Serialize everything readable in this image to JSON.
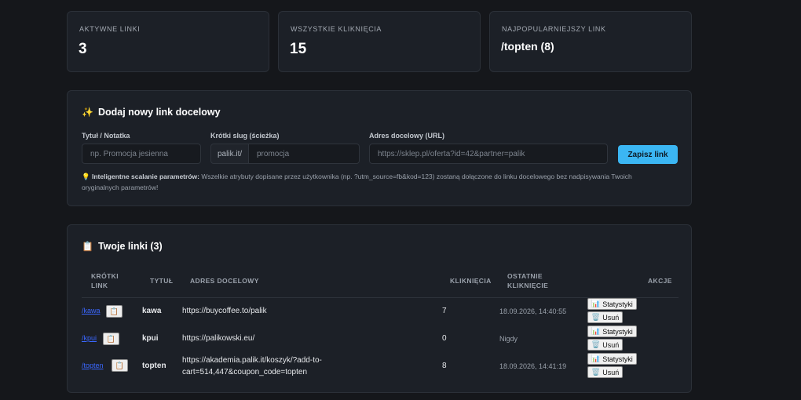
{
  "stats": [
    {
      "label": "AKTYWNE LINKI",
      "value": "3"
    },
    {
      "label": "WSZYSTKIE KLIKNIĘCIA",
      "value": "15"
    },
    {
      "label": "NAJPOPULARNIEJSZY LINK",
      "value": "/topten (8)"
    }
  ],
  "form": {
    "icon": "✨",
    "title": "Dodaj nowy link docelowy",
    "title_label": "Tytuł / Notatka",
    "title_placeholder": "np. Promocja jesienna",
    "slug_label": "Krótki slug (ścieżka)",
    "slug_prefix": "palik.it/",
    "slug_placeholder": "promocja",
    "url_label": "Adres docelowy (URL)",
    "url_placeholder": "https://sklep.pl/oferta?id=42&partner=palik",
    "save_label": "Zapisz link",
    "hint_icon": "💡",
    "hint_bold": "Inteligentne scalanie parametrów:",
    "hint_line1": " Wszelkie atrybuty dopisane przez użytkownika (np. ?utm_source=fb&kod=123) zostaną dołączone do linku docelowego bez nadpisywania Twoich",
    "hint_line2": "oryginalnych parametrów!"
  },
  "links": {
    "icon": "📋",
    "title": "Twoje linki (3)",
    "headers": {
      "short_1": "KRÓTKI",
      "short_2": "LINK",
      "title": "TYTUŁ",
      "target": "ADRES DOCELOWY",
      "clicks": "KLIKNIĘCIA",
      "last_1": "OSTATNIE",
      "last_2": "KLIKNIĘCIE",
      "actions": "AKCJE"
    },
    "copy_icon": "📋",
    "stats_icon": "📊",
    "stats_label": "Statystyki",
    "delete_icon": "🗑️",
    "delete_label": "Usuń",
    "rows": [
      {
        "short": "/kawa",
        "title": "kawa",
        "url_1": "https://buycoffee.to/palik",
        "url_2": "",
        "clicks": "7",
        "last": "18.09.2026, 14:40:55"
      },
      {
        "short": "/kpui",
        "title": "kpui",
        "url_1": "https://palikowski.eu/",
        "url_2": "",
        "clicks": "0",
        "last": "Nigdy"
      },
      {
        "short": "/topten",
        "title": "topten",
        "url_1": "https://akademia.palik.it/koszyk/?add-to-",
        "url_2": "cart=514,447&coupon_code=topten",
        "clicks": "8",
        "last": "18.09.2026, 14:41:19"
      }
    ]
  }
}
